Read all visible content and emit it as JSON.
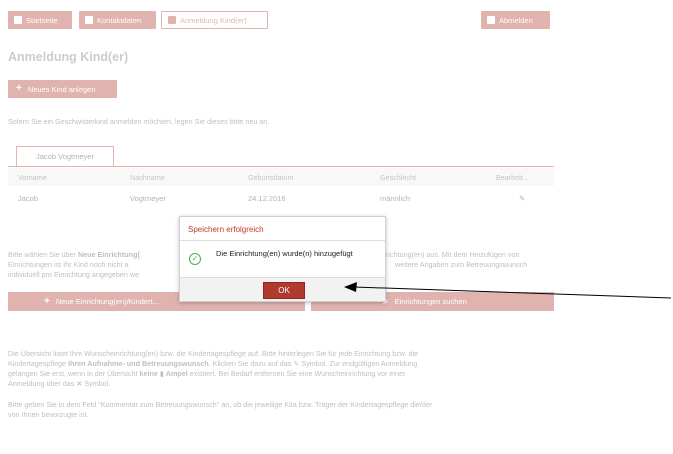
{
  "topnav": {
    "home": "Startseite",
    "contact": "Kontaktdaten",
    "register": "Anmeldung Kind(er)",
    "logout": "Abmelden"
  },
  "page": {
    "title": "Anmeldung Kind(er)",
    "new_child_button": "Neues Kind anlegen",
    "sibling_hint": "Sofern Sie ein Geschwisterkind anmelden möchten, legen Sie dieses bitte neu an."
  },
  "child_tab": "Jacob Vogtmeyer",
  "table": {
    "headers": [
      "Vorname",
      "Nachname",
      "Geburtsdatum",
      "Geschlecht",
      "Bearbeit..."
    ],
    "row": [
      "Jacob",
      "Vogtmeyer",
      "24.12.2016",
      "männlich"
    ]
  },
  "info1": {
    "line1_a": "Bitte wählen Sie über",
    "line1_b": "Neue Einrichtung(",
    "line1_c": "richtung(en) aus. Mit dem Hinzufügen von",
    "line2_a": "Einrichtungen ist Ihr Kind noch nicht a",
    "line2_b": "weitere Angaben zum Betreuungswunsch",
    "line3": "individuell pro Einrichtung angegeben we"
  },
  "buttons": {
    "new_facility": "Neue Einrichtung(en)/Kindert...",
    "search_facilities": "Einrichtungen suchen"
  },
  "info2": {
    "l1": "Die Übersicht listet Ihre Wunscheinrichtung(en) bzw. die Kindertagespflege auf. Bitte hinterlegen Sie für jede Einrichtung bzw. die",
    "l2_a": "Kindertagespflege",
    "l2_b": "Ihren Aufnahme- und Betreuungswunsch",
    "l2_c": ". Klicken Sie dazu auf das",
    "l2_d": "Symbol. Zur endgültigen Anmeldung",
    "l3_a": "gelangen Sie erst, wenn in der Übersicht",
    "l3_b": "keine",
    "l3_c": "Ampel",
    "l3_d": "existiert. Bei Bedarf entfernen Sie eine Wunscheinrichtung vor einer",
    "l4_a": "Anmeldung über das",
    "l4_b": "Symbol."
  },
  "info3": {
    "l1": "Bitte geben Sie in dem Feld \"Kommentar zum Betreuungswunsch\" an, ob die jeweilige Kita bzw. Träger der Kindertagespflege die/der",
    "l2": "von Ihnen bevorzugte ist."
  },
  "dialog": {
    "title": "Speichern erfolgreich",
    "message": "Die Einrichtung(en) wurde(n) hinzugefügt",
    "ok": "OK"
  },
  "colors": {
    "accent": "#b03a2e",
    "success": "#4caf50"
  }
}
